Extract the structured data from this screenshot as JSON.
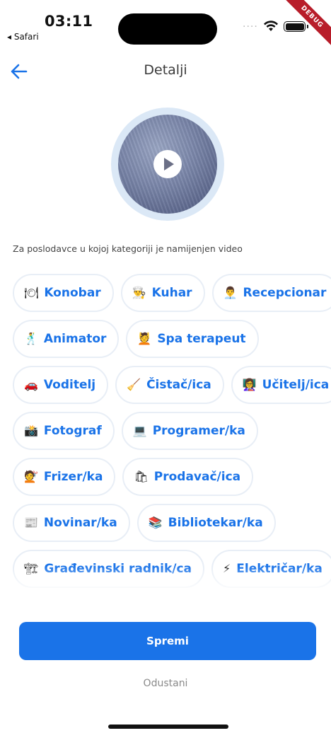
{
  "status": {
    "time": "03:11",
    "back_app": "◂ Safari",
    "debug": "DEBUG"
  },
  "header": {
    "title": "Detalji",
    "back_icon": "arrow-left-icon"
  },
  "video": {
    "play_icon": "play-icon"
  },
  "section_label": "Za poslodavce u kojoj kategoriji je namijenjen video",
  "categories": [
    {
      "icon": "🍽",
      "label": "Konobar"
    },
    {
      "icon": "👨‍🍳",
      "label": "Kuhar"
    },
    {
      "icon": "👨‍💼",
      "label": "Recepcionar"
    },
    {
      "icon": "🕺",
      "label": "Animator"
    },
    {
      "icon": "💆",
      "label": "Spa terapeut"
    },
    {
      "icon": "🚗",
      "label": "Voditelj"
    },
    {
      "icon": "🧹",
      "label": "Čistač/ica"
    },
    {
      "icon": "👩‍🏫",
      "label": "Učitelj/ica"
    },
    {
      "icon": "📸",
      "label": "Fotograf"
    },
    {
      "icon": "💻",
      "label": "Programer/ka"
    },
    {
      "icon": "💇",
      "label": "Frizer/ka"
    },
    {
      "icon": "🛍",
      "label": "Prodavač/ica"
    },
    {
      "icon": "📰",
      "label": "Novinar/ka"
    },
    {
      "icon": "📚",
      "label": "Bibliotekar/ka"
    },
    {
      "icon": "🏗",
      "label": "Građevinski radnik/ca"
    },
    {
      "icon": "⚡",
      "label": "Električar/ka"
    }
  ],
  "actions": {
    "save_label": "Spremi",
    "cancel_label": "Odustani"
  },
  "colors": {
    "accent": "#1a73e8",
    "chip_border": "#e8eef6",
    "video_ring": "#dbe8f6"
  }
}
